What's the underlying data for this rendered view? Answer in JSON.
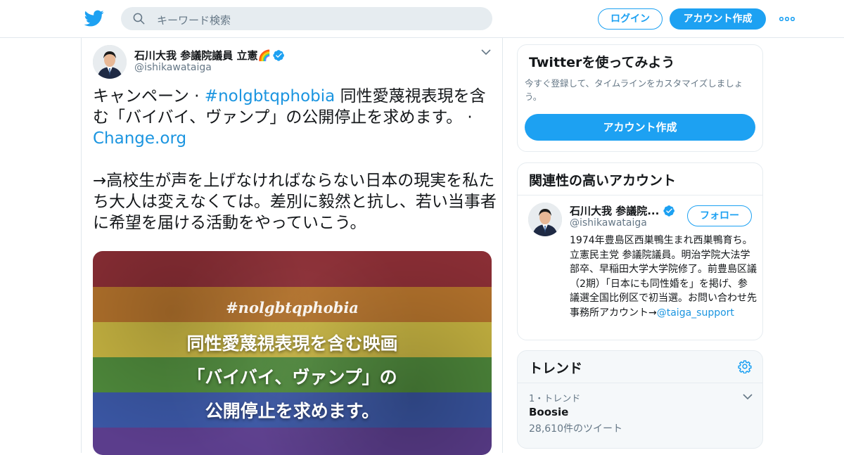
{
  "header": {
    "search_placeholder": "キーワード検索",
    "login_label": "ログイン",
    "signup_label": "アカウント作成",
    "accent_color": "#1da1f2"
  },
  "tweet": {
    "author_name": "石川大我 参議院議員 立憲",
    "author_emoji": "🌈",
    "author_handle": "@ishikawataiga",
    "text_part1": "キャンペーン · ",
    "hashtag": "#nolgbtqphobia",
    "text_part2": " 同性愛蔑視表現を含む「バイバイ、ヴァンプ」の公開停止を求めます。 · ",
    "link": "Change.org",
    "text_para2": "→高校生が声を上げなければならない日本の現実を私たち大人は変えなくては。差別に毅然と抗し、若い当事者に希望を届ける活動をやっていこう。",
    "media": {
      "tag": "#nolgbtqphobia",
      "line1": "同性愛蔑視表現を含む映画",
      "line2": "「バイバイ、ヴァンプ」の",
      "line3": "公開停止を求めます。",
      "stripe_colors": [
        "#8a2e35",
        "#b4732c",
        "#c9b642",
        "#4f8a3c",
        "#3a56a3",
        "#5b3d8c"
      ]
    }
  },
  "signup_card": {
    "title": "Twitterを使ってみよう",
    "subtitle": "今すぐ登録して、タイムラインをカスタマイズしましょう。",
    "button_label": "アカウント作成"
  },
  "related": {
    "title": "関連性の高いアカウント",
    "account": {
      "name": "石川大我 参議院...",
      "handle": "@ishikawataiga",
      "follow_label": "フォロー",
      "bio": "1974年豊島区西巣鴨生まれ西巣鴨育ち。立憲民主党 参議院議員。明治学院大法学部卒、早稲田大学大学院修了。前豊島区議（2期）「日本にも同性婚を」を掲げ、参議選全国比例区で初当選。お問い合わせ先　事務所アカウント→",
      "bio_link": "@taiga_support"
    }
  },
  "trends": {
    "title": "トレンド",
    "items": [
      {
        "rank": "1・トレンド",
        "name": "Boosie",
        "count": "28,610件のツイート"
      }
    ]
  }
}
